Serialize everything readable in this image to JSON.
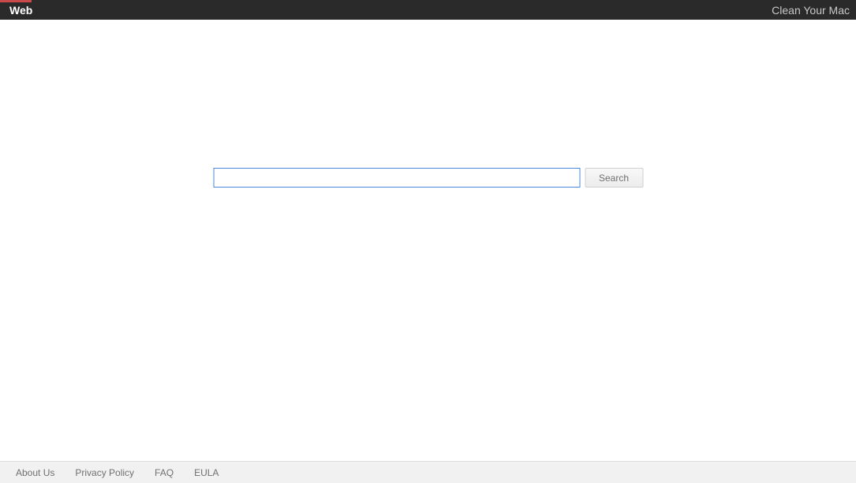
{
  "header": {
    "title": "Web",
    "right_link": "Clean Your Mac"
  },
  "search": {
    "input_value": "",
    "button_label": "Search"
  },
  "footer": {
    "links": [
      "About Us",
      "Privacy Policy",
      "FAQ",
      "EULA"
    ]
  }
}
